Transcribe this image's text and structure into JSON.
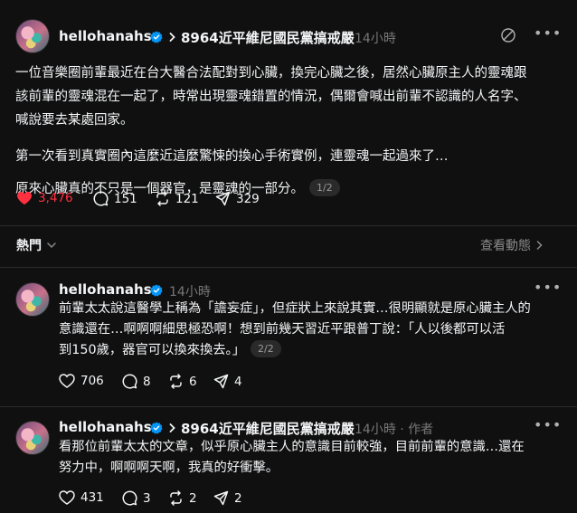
{
  "post": {
    "username": "hellohanahsu",
    "topic": "8964近平維尼國民黨搞戒嚴",
    "time": "14小時",
    "lines": [
      "一位音樂圈前輩最近在台大醫合法配對到心臟，換完心臟之後，居然心臟原主人的靈魂跟",
      "該前輩的靈魂混在一起了，時常出現靈魂錯置的情況，偶爾會喊出前輩不認識的人名字、",
      "喊說要去某處回家。",
      "第一次看到真實圈內這麼近這麼驚悚的換心手術實例，連靈魂一起過來了…",
      "原來心臟真的不只是一個器官，是靈魂的一部分。"
    ],
    "page_badge": "1/2",
    "likes": "3,476",
    "comments": "151",
    "reposts": "121",
    "shares": "329"
  },
  "sort": {
    "label": "熱門",
    "view_activity": "查看動態"
  },
  "replies": [
    {
      "username": "hellohanahsu",
      "time": "14小時",
      "lines": [
        "前輩太太說這醫學上稱為「譫妄症」，但症狀上來說其實…很明顯就是原心臟主人的",
        "意識還在…啊啊啊細思極恐啊！想到前幾天習近平跟普丁說：「人以後都可以活",
        "到150歲，器官可以換來換去。」"
      ],
      "page_badge": "2/2",
      "likes": "706",
      "comments": "8",
      "reposts": "6",
      "shares": "4"
    },
    {
      "username": "hellohanahsu",
      "topic": "8964近平維尼國民黨搞戒嚴",
      "time": "14小時",
      "author_tag": "作者",
      "lines": [
        "看那位前輩太太的文章，似乎原心臟主人的意識目前較強，目前前輩的意識…還在",
        "努力中，啊啊啊天啊，我真的好衝擊。"
      ],
      "likes": "431",
      "comments": "3",
      "reposts": "2",
      "shares": "2"
    }
  ],
  "colors": {
    "background": "#101010",
    "liked": "#ff3040",
    "verified": "#0095f6",
    "muted": "#777777"
  },
  "icons": [
    "verified-badge-icon",
    "chevron-right-icon",
    "mute-icon",
    "more-icon",
    "heart-icon",
    "comment-icon",
    "repost-icon",
    "share-icon",
    "chevron-down-icon"
  ]
}
